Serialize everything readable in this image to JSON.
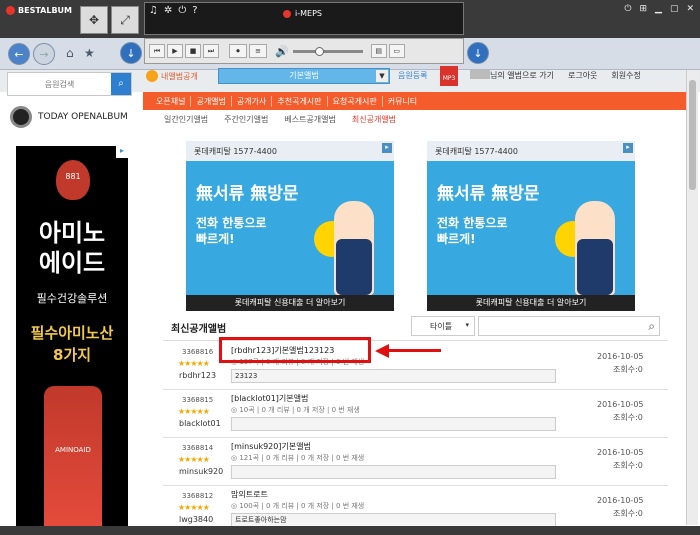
{
  "app": {
    "name": "BESTALBUM",
    "player_name": "i-MEPS"
  },
  "toolbar": {
    "search_placeholder": "음원검색",
    "album_open_label": "내앨범공개",
    "album_select_value": "기본앨범",
    "register_label": "음원등록",
    "mp3_label": "MP3"
  },
  "user_links": {
    "go_album": "님의 앨범으로 가기",
    "logout": "로그아웃",
    "account": "회원수정"
  },
  "nav_menu": [
    "오픈채널",
    "공개앨범",
    "공개가사",
    "추천곡게시판",
    "요청곡게시판",
    "커뮤니티"
  ],
  "logo_text": "TODAY OPENALBUM",
  "tabs": [
    "일간인기앨범",
    "주간인기앨범",
    "베스트공개앨범",
    "최신공개앨범"
  ],
  "left_ad": {
    "brand": "881",
    "line1": "아미노",
    "line2": "에이드",
    "line3": "필수건강솔루션",
    "line4": "필수아미노산",
    "line5": "8가지",
    "product": "AMINOAID"
  },
  "ad": {
    "header": "롯데캐피탈  1577-4400",
    "big": "無서류 無방문",
    "sub1": "전화 한통으로",
    "sub2": "빠르게!",
    "footer": "롯데캐피탈 신용대출 더 알아보기"
  },
  "section": {
    "title": "최신공개앨범",
    "sort_label": "타이틀"
  },
  "albums": [
    {
      "id": "3368816",
      "user": "rbdhr123",
      "title": "[rbdhr123]기본앨범123123",
      "meta": "137곡 | 0 개 리뷰 | 0 개 저장 | 0 번 재생",
      "desc": "23123",
      "date": "2016-10-05",
      "views": "조회수:0"
    },
    {
      "id": "3368815",
      "user": "blacklot01",
      "title": "[blacklot01]기본앨범",
      "meta": "10곡 | 0 개 리뷰 | 0 개 저장 | 0 번 재생",
      "desc": "",
      "date": "2016-10-05",
      "views": "조회수:0"
    },
    {
      "id": "3368814",
      "user": "minsuk920",
      "title": "[minsuk920]기본앨범",
      "meta": "121곡 | 0 개 리뷰 | 0 개 저장 | 0 번 재생",
      "desc": "",
      "date": "2016-10-05",
      "views": "조회수:0"
    },
    {
      "id": "3368812",
      "user": "lwg3840",
      "title": "맘의트로트",
      "meta": "100곡 | 0 개 리뷰 | 0 개 저장 | 0 번 재생",
      "desc": "트로트좋아하는맘",
      "date": "2016-10-05",
      "views": "조회수:0"
    }
  ],
  "colors": {
    "accent": "#f45c2c",
    "highlight": "#e01010",
    "ad_blue": "#37a8e0"
  }
}
